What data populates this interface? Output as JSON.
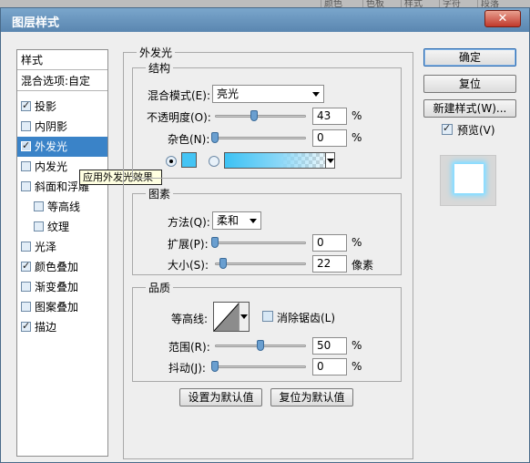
{
  "background_tabs": [
    "颜色",
    "色板",
    "样式",
    "字符",
    "段落"
  ],
  "window": {
    "title": "图层样式",
    "close_label": "✕"
  },
  "styles_list": {
    "header": "样式",
    "blend_options": "混合选项:自定",
    "items": [
      {
        "label": "投影",
        "checked": true,
        "indent": false
      },
      {
        "label": "内阴影",
        "checked": false,
        "indent": false
      },
      {
        "label": "外发光",
        "checked": true,
        "indent": false,
        "selected": true
      },
      {
        "label": "内发光",
        "checked": false,
        "indent": false
      },
      {
        "label": "斜面和浮雕",
        "checked": false,
        "indent": false
      },
      {
        "label": "等高线",
        "checked": false,
        "indent": true
      },
      {
        "label": "纹理",
        "checked": false,
        "indent": true
      },
      {
        "label": "光泽",
        "checked": false,
        "indent": false
      },
      {
        "label": "颜色叠加",
        "checked": true,
        "indent": false
      },
      {
        "label": "渐变叠加",
        "checked": false,
        "indent": false
      },
      {
        "label": "图案叠加",
        "checked": false,
        "indent": false
      },
      {
        "label": "描边",
        "checked": true,
        "indent": false
      }
    ],
    "tooltip": "应用外发光效果"
  },
  "panel": {
    "title": "外发光",
    "structure": {
      "title": "结构",
      "blend_mode_label": "混合模式(E):",
      "blend_mode_value": "亮光",
      "opacity_label": "不透明度(O):",
      "opacity_value": "43",
      "opacity_fraction": 0.43,
      "noise_label": "杂色(N):",
      "noise_value": "0",
      "noise_fraction": 0,
      "percent": "%",
      "glow_color": "#44c4f4"
    },
    "elements": {
      "title": "图素",
      "technique_label": "方法(Q):",
      "technique_value": "柔和",
      "spread_label": "扩展(P):",
      "spread_value": "0",
      "spread_fraction": 0,
      "size_label": "大小(S):",
      "size_value": "22",
      "size_fraction": 0.09,
      "percent": "%",
      "pixels": "像素"
    },
    "quality": {
      "title": "品质",
      "contour_label": "等高线:",
      "anti_alias_label": "消除锯齿(L)",
      "anti_alias_checked": false,
      "range_label": "范围(R):",
      "range_value": "50",
      "range_fraction": 0.5,
      "jitter_label": "抖动(J):",
      "jitter_value": "0",
      "jitter_fraction": 0,
      "percent": "%"
    },
    "set_default_label": "设置为默认值",
    "reset_default_label": "复位为默认值"
  },
  "buttons": {
    "ok": "确定",
    "reset": "复位",
    "new_style": "新建样式(W)...",
    "preview_label": "预览(V)",
    "preview_checked": true
  }
}
